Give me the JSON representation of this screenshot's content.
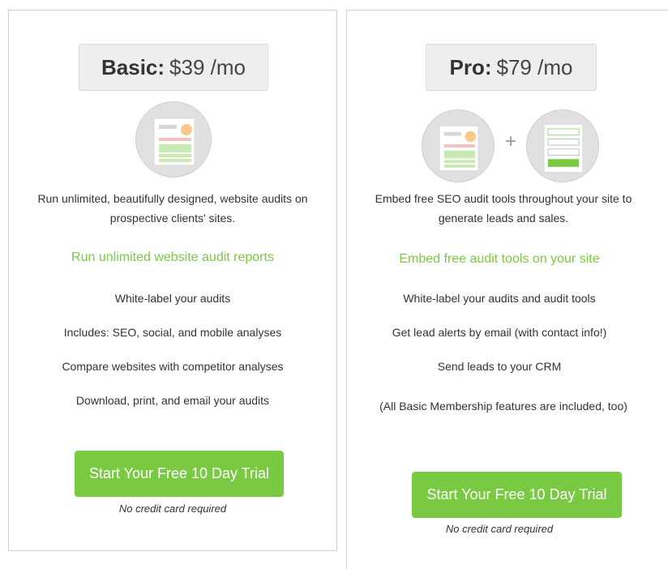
{
  "basic": {
    "tier": "Basic:",
    "amount": "$39 /mo",
    "description": "Run unlimited, beautifully designed, website audits on prospective clients' sites.",
    "headline": "Run unlimited website audit reports",
    "features": [
      "White-label your audits",
      "Includes: SEO, social, and mobile analyses",
      "Compare websites with competitor analyses",
      "Download, print, and email your audits"
    ],
    "cta_label": "Start Your Free 10 Day Trial",
    "note": "No credit card required"
  },
  "pro": {
    "tier": "Pro:",
    "amount": "$79 /mo",
    "plus": "+",
    "description": "Embed free SEO audit tools throughout your site to generate leads and sales.",
    "headline": "Embed free audit tools on your site",
    "features": [
      "White-label your audits and audit tools",
      "Get lead alerts by email (with contact info!)",
      "Send leads to your CRM",
      "(All Basic Membership features are included, too)"
    ],
    "cta_label": "Start Your Free 10 Day Trial",
    "note": "No credit card required"
  },
  "colors": {
    "accent": "#7ac943",
    "price_box_bg": "#eeeeee",
    "icon_circle_bg": "#e0e0e0"
  },
  "icons": [
    "report-icon",
    "embed-form-icon"
  ]
}
